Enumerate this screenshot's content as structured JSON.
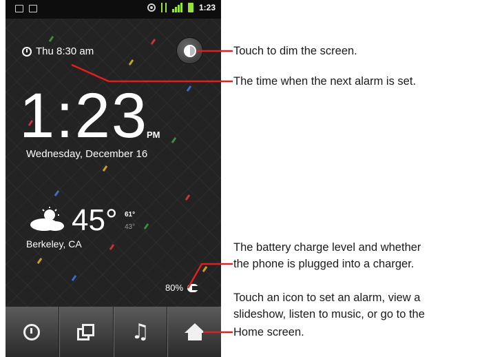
{
  "status_bar": {
    "time": "1:23",
    "icons": [
      "mail-icon",
      "sd-card-icon",
      "gps-icon",
      "usb-debug-icon",
      "signal-icon",
      "battery-icon"
    ],
    "accent_color": "#9be23a"
  },
  "lock_screen": {
    "next_alarm": "Thu 8:30 am",
    "time": "1:23",
    "ampm": "PM",
    "date": "Wednesday, December 16",
    "weather": {
      "icon": "partly-cloudy-icon",
      "temp": "45°",
      "high": "61°",
      "low": "43°",
      "location": "Berkeley, CA"
    },
    "battery": "80%",
    "dim_button_icon": "brightness-icon"
  },
  "dock": [
    {
      "icon": "alarm-clock-icon"
    },
    {
      "icon": "slideshow-icon"
    },
    {
      "icon": "music-icon",
      "glyph": "♫"
    },
    {
      "icon": "home-icon"
    }
  ],
  "callouts": {
    "dim": "Touch to dim the screen.",
    "alarm": "The time when the next alarm is set.",
    "battery_1": "The battery charge level and whether",
    "battery_2": "the phone is plugged into a charger.",
    "icons_1": "Touch an icon to set an alarm, view a",
    "icons_2": "slideshow, listen to music, or go to the",
    "icons_3": "Home screen."
  }
}
